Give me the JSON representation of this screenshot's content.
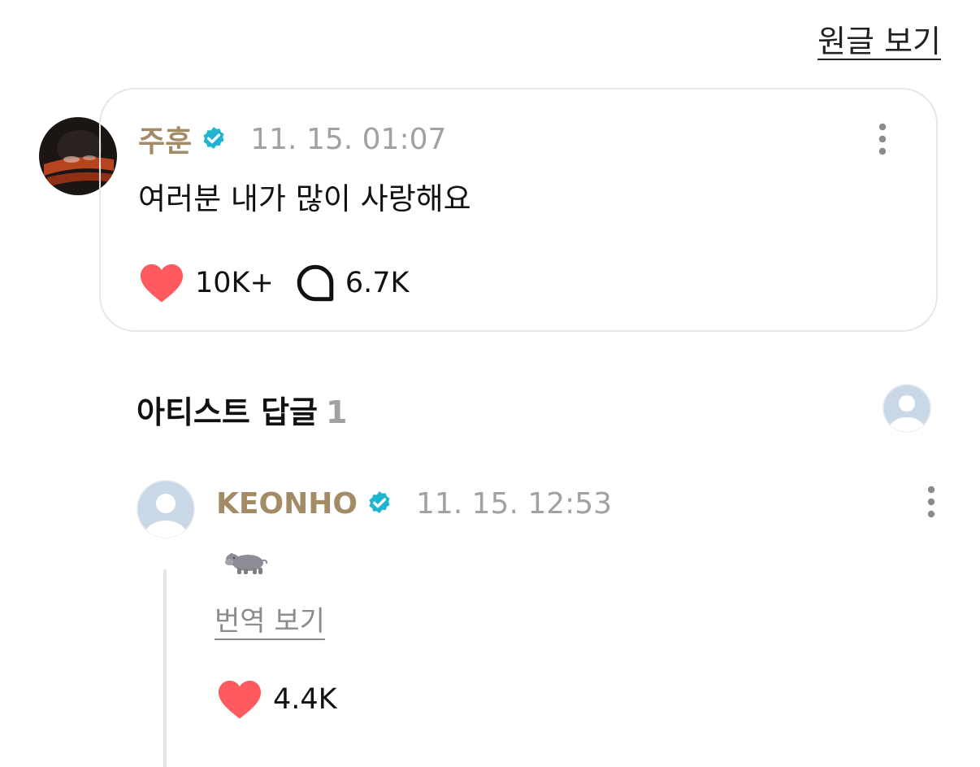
{
  "header": {
    "view_original_label": "원글 보기"
  },
  "post": {
    "author": "주훈",
    "verified": true,
    "timestamp": "11. 15. 01:07",
    "body": "여러분 내가 많이 사랑해요",
    "likes": "10K+",
    "comments": "6.7K",
    "more_icon": "more-vertical-icon",
    "like_icon": "heart-icon",
    "comment_icon": "comment-bubble-icon"
  },
  "artist_replies": {
    "title": "아티스트 답글",
    "count": "1"
  },
  "reply": {
    "author": "KEONHO",
    "verified": true,
    "timestamp": "11. 15. 12:53",
    "body": "🦛",
    "translate_label": "번역 보기",
    "likes": "4.4K"
  },
  "colors": {
    "author_name": "#a38b66",
    "verified_badge": "#1fb5d0",
    "heart": "#ff5a5f",
    "muted_text": "#a0a0a5",
    "card_border": "#e6e6e9",
    "default_avatar_bg": "#c9d8e6"
  }
}
